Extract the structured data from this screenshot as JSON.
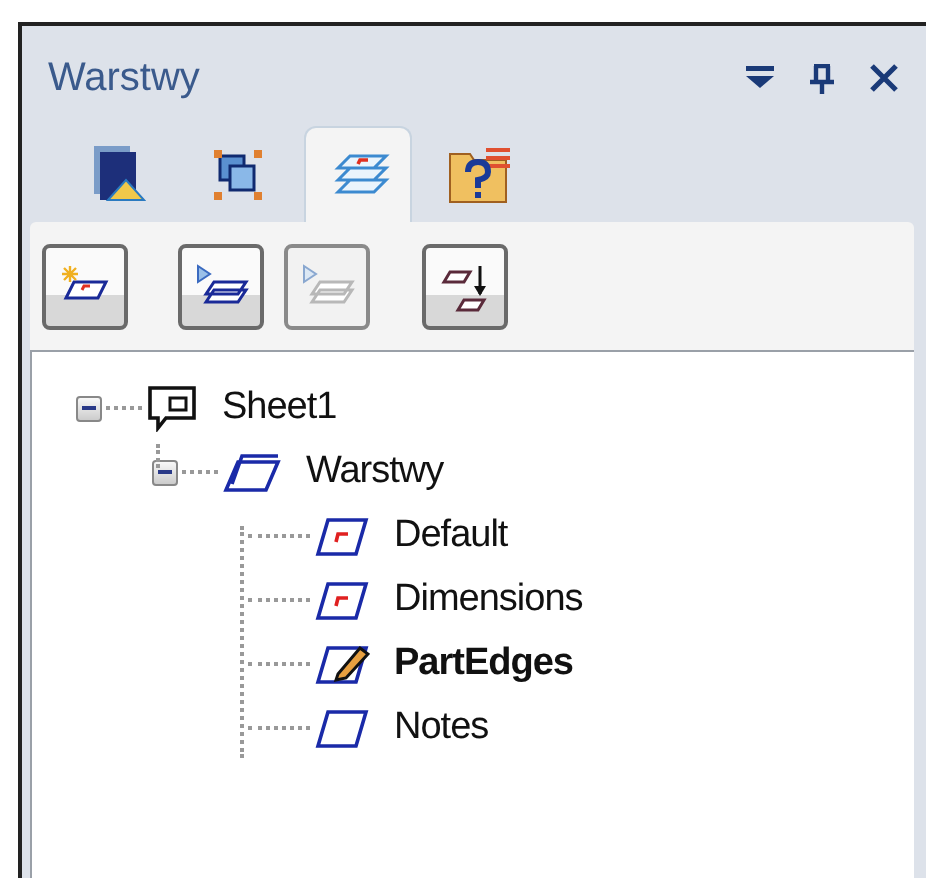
{
  "panel": {
    "title": "Warstwy"
  },
  "tabs": [
    {
      "kind": "sheets",
      "selected": false
    },
    {
      "kind": "selection",
      "selected": false
    },
    {
      "kind": "layers",
      "selected": true
    },
    {
      "kind": "help",
      "selected": false
    }
  ],
  "toolbar": [
    {
      "kind": "new-layer",
      "disabled": false
    },
    {
      "kind": "show-layer",
      "disabled": false
    },
    {
      "kind": "hide-layer",
      "disabled": true
    },
    {
      "kind": "move-layer",
      "disabled": false
    }
  ],
  "tree": [
    {
      "label": "Sheet1",
      "kind": "sheet",
      "expanded": true,
      "children": [
        {
          "label": "Warstwy",
          "kind": "layers",
          "expanded": true,
          "children": [
            {
              "label": "Default",
              "kind": "marked",
              "active": false
            },
            {
              "label": "Dimensions",
              "kind": "marked",
              "active": false
            },
            {
              "label": "PartEdges",
              "kind": "plain",
              "active": true
            },
            {
              "label": "Notes",
              "kind": "plain",
              "active": false
            }
          ]
        }
      ]
    }
  ]
}
